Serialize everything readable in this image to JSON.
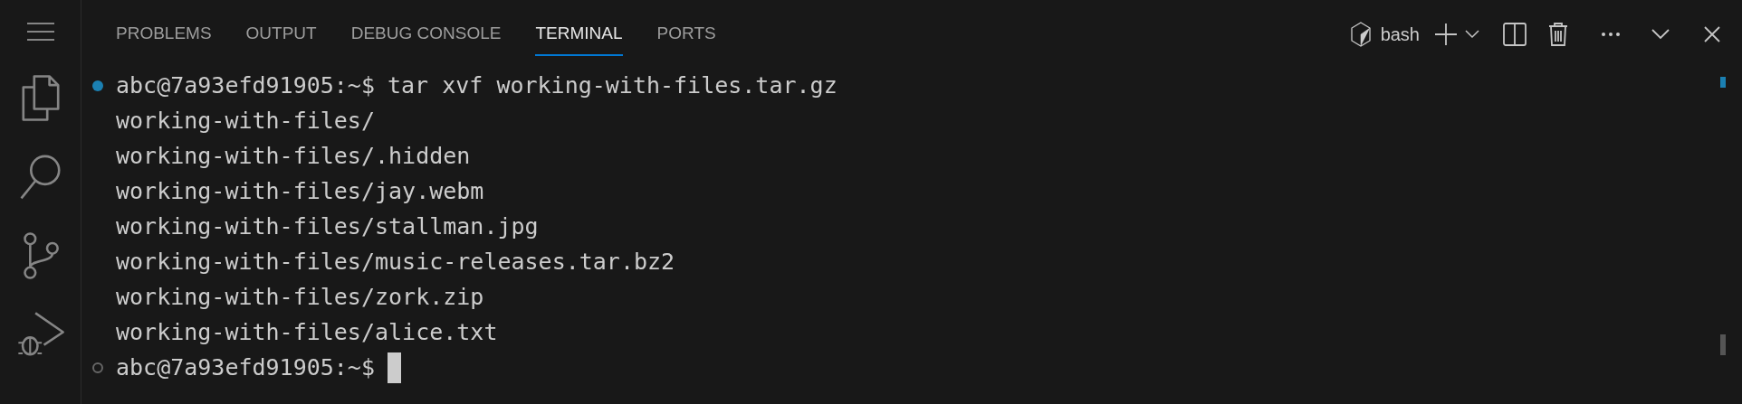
{
  "panel_tabs": [
    {
      "label": "PROBLEMS",
      "selected": false
    },
    {
      "label": "OUTPUT",
      "selected": false
    },
    {
      "label": "DEBUG CONSOLE",
      "selected": false
    },
    {
      "label": "TERMINAL",
      "selected": true
    },
    {
      "label": "PORTS",
      "selected": false
    }
  ],
  "terminal_selector": {
    "label": "bash"
  },
  "terminal": {
    "lines": [
      {
        "kind": "command",
        "succeeded": true,
        "prompt": "abc@7a93efd91905:~$",
        "text": "tar xvf working-with-files.tar.gz"
      },
      {
        "kind": "output",
        "text": "working-with-files/"
      },
      {
        "kind": "output",
        "text": "working-with-files/.hidden"
      },
      {
        "kind": "output",
        "text": "working-with-files/jay.webm"
      },
      {
        "kind": "output",
        "text": "working-with-files/stallman.jpg"
      },
      {
        "kind": "output",
        "text": "working-with-files/music-releases.tar.bz2"
      },
      {
        "kind": "output",
        "text": "working-with-files/zork.zip"
      },
      {
        "kind": "output",
        "text": "working-with-files/alice.txt"
      },
      {
        "kind": "command",
        "succeeded": false,
        "prompt": "abc@7a93efd91905:~$",
        "cursor": true
      }
    ]
  }
}
